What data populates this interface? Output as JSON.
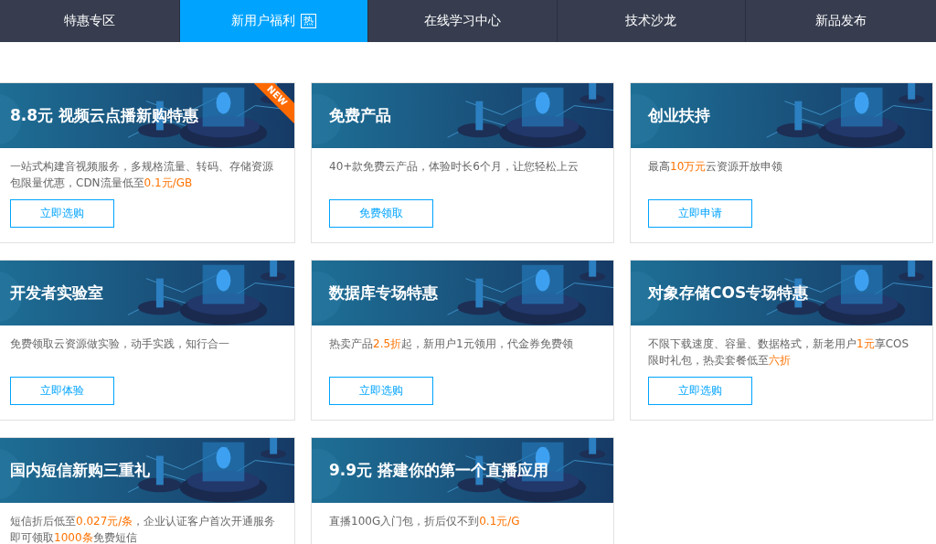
{
  "tabs": [
    {
      "label": "特惠专区",
      "selected": false
    },
    {
      "label": "新用户福利",
      "selected": true,
      "badge": "热"
    },
    {
      "label": "在线学习中心",
      "selected": false
    },
    {
      "label": "技术沙龙",
      "selected": false
    },
    {
      "label": "新品发布",
      "selected": false
    }
  ],
  "cards": [
    {
      "title": "8.8元 视频云点播新购特惠",
      "ribbon": "NEW",
      "description": [
        {
          "text": "一站式构建音视频服务，多规格流量、转码、存储资源包限量优惠，CDN流量低至",
          "highlight": false
        },
        {
          "text": "0.1元/GB",
          "highlight": true
        }
      ],
      "button": "立即选购"
    },
    {
      "title": "免费产品",
      "description": [
        {
          "text": "40+款免费云产品，体验时长6个月，让您轻松上云",
          "highlight": false
        }
      ],
      "button": "免费领取"
    },
    {
      "title": "创业扶持",
      "description": [
        {
          "text": "最高",
          "highlight": false
        },
        {
          "text": "10万元",
          "highlight": true
        },
        {
          "text": "云资源开放申领",
          "highlight": false
        }
      ],
      "button": "立即申请"
    },
    {
      "title": "开发者实验室",
      "description": [
        {
          "text": "免费领取云资源做实验，动手实践，知行合一",
          "highlight": false
        }
      ],
      "button": "立即体验"
    },
    {
      "title": "数据库专场特惠",
      "description": [
        {
          "text": "热卖产品",
          "highlight": false
        },
        {
          "text": "2.5折",
          "highlight": true
        },
        {
          "text": "起，新用户1元领用，代金券免费领",
          "highlight": false
        }
      ],
      "button": "立即选购"
    },
    {
      "title": "对象存储COS专场特惠",
      "description": [
        {
          "text": "不限下载速度、容量、数据格式，新老用户",
          "highlight": false
        },
        {
          "text": "1元",
          "highlight": true
        },
        {
          "text": "享COS限时礼包，热卖套餐低至",
          "highlight": false
        },
        {
          "text": "六折",
          "highlight": true
        }
      ],
      "button": "立即选购"
    },
    {
      "title": "国内短信新购三重礼",
      "description": [
        {
          "text": "短信折后低至",
          "highlight": false
        },
        {
          "text": "0.027元/条",
          "highlight": true
        },
        {
          "text": "，企业认证客户首次开通服务即可领取",
          "highlight": false
        },
        {
          "text": "1000条",
          "highlight": true
        },
        {
          "text": "免费短信",
          "highlight": false
        }
      ]
    },
    {
      "title": "9.9元 搭建你的第一个直播应用",
      "description": [
        {
          "text": "直播100G入门包，折后仅不到",
          "highlight": false
        },
        {
          "text": "0.1元/G",
          "highlight": true
        }
      ]
    }
  ]
}
